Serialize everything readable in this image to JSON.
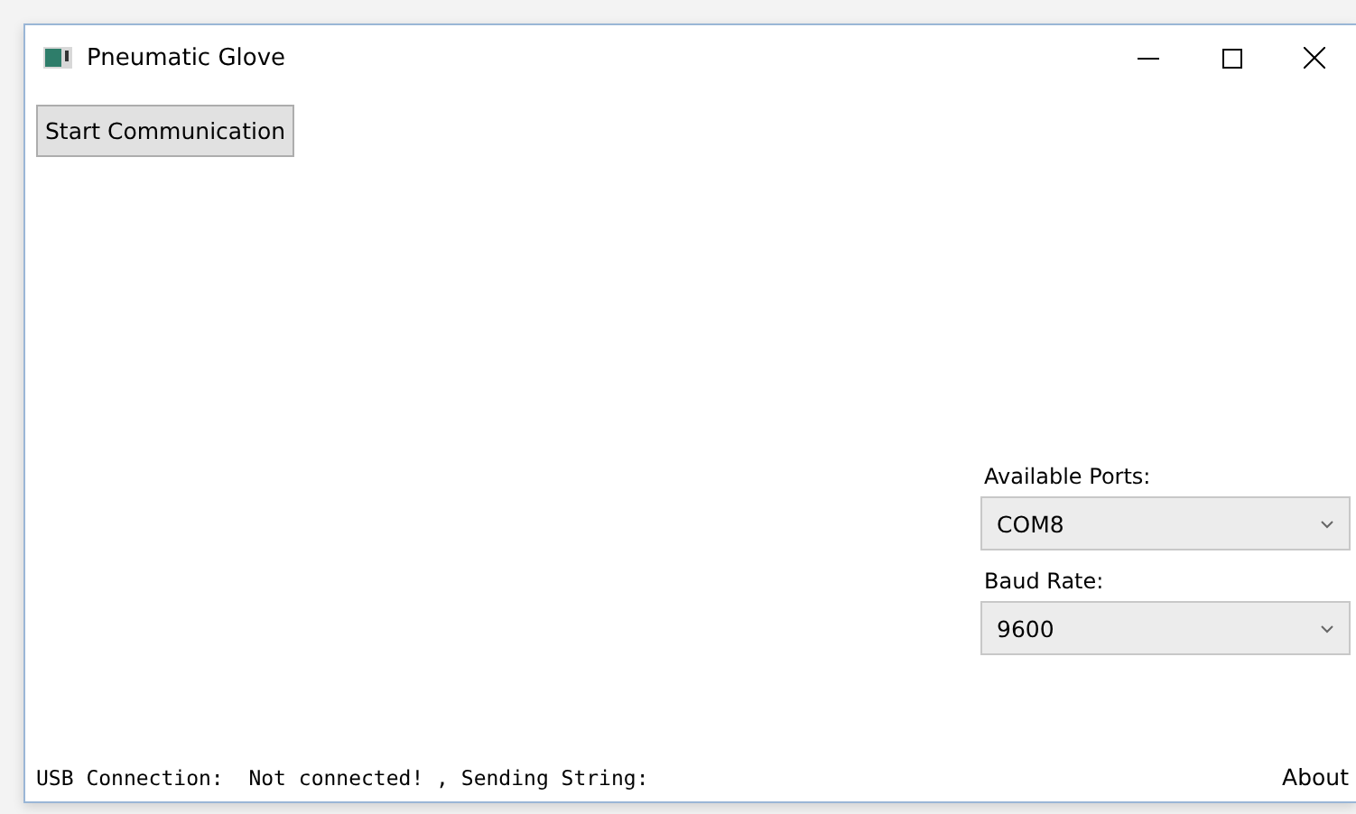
{
  "window": {
    "title": "Pneumatic Glove"
  },
  "start_button": "Start Communication",
  "ports": {
    "label": "Available Ports:",
    "value": "COM8"
  },
  "baud": {
    "label": "Baud Rate:",
    "value": "9600"
  },
  "status": "USB Connection:  Not connected! , Sending String:",
  "about": "About"
}
